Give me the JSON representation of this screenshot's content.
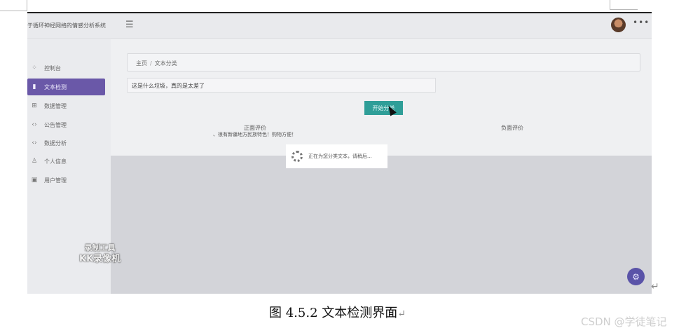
{
  "app": {
    "title": "于循环神经网络的情感分析系统",
    "menu_icon": "☰",
    "more_icon": "•••"
  },
  "sidebar": {
    "items": [
      {
        "label": "控制台",
        "icon": "dashboard-icon"
      },
      {
        "label": "文本检测",
        "icon": "bar-chart-icon"
      },
      {
        "label": "数据管理",
        "icon": "grid-icon"
      },
      {
        "label": "公告管理",
        "icon": "code-icon"
      },
      {
        "label": "数据分析",
        "icon": "code-icon"
      },
      {
        "label": "个人信息",
        "icon": "user-icon"
      },
      {
        "label": "用户管理",
        "icon": "document-icon"
      }
    ],
    "active_index": 1
  },
  "watermark": {
    "line1": "录制工具",
    "line2": "KK录像机"
  },
  "breadcrumb": {
    "home": "主页",
    "separator": "/",
    "current": "文本分类"
  },
  "input": {
    "value": "这是什么垃圾，真的是太差了"
  },
  "start_button": {
    "label": "开始分类"
  },
  "results": {
    "positive_header": "正面评价",
    "positive_text": "、很有新疆地方民族特色！购物方便！",
    "negative_header": "负面评价"
  },
  "loading": {
    "text": "正在为您分类文本，请稍后..."
  },
  "caption": {
    "text": "图 4.5.2  文本检测界面"
  },
  "csdn_watermark": "CSDN @学徒笔记",
  "colors": {
    "accent": "#6a58a8",
    "button": "#2f9e98",
    "overlay": "#d3d4d9"
  }
}
